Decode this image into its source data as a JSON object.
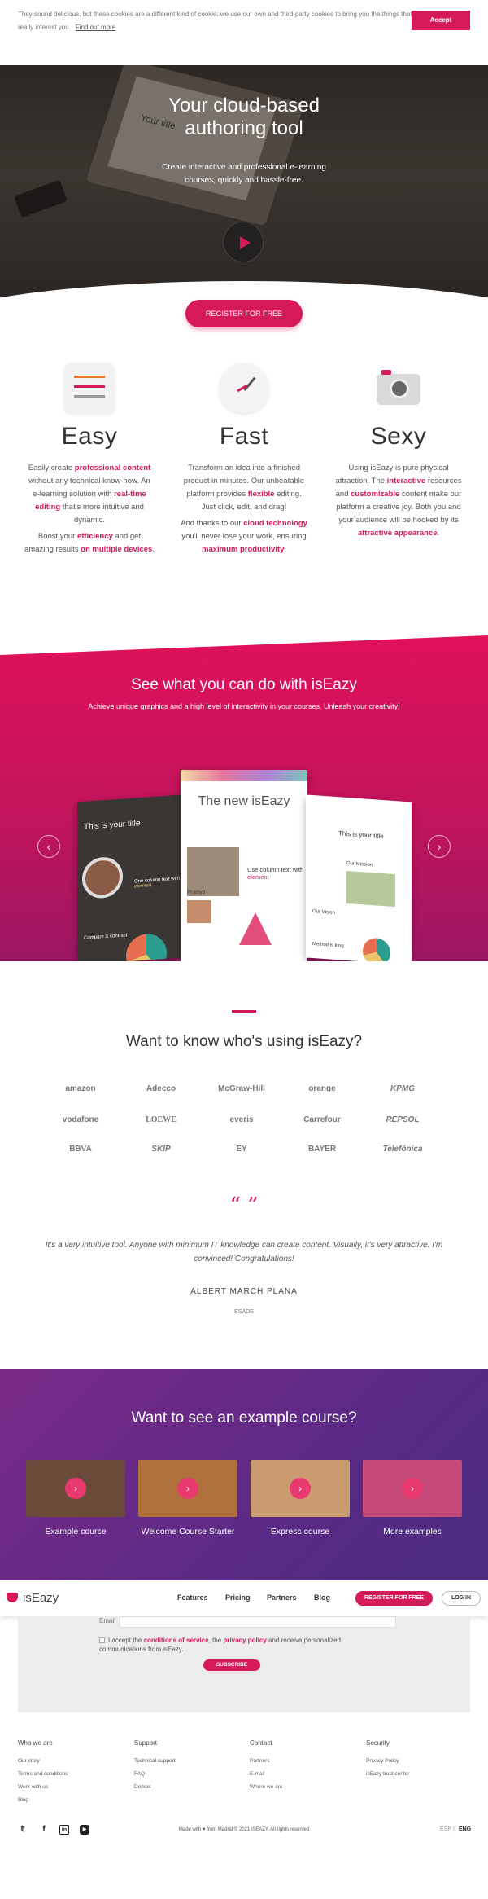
{
  "cookie": {
    "text": "They sound delicious, but these cookies are a different kind of cookie: we use our own and third-party cookies to bring you the things that really interest you.",
    "link": "Find out more",
    "accept": "Accept"
  },
  "hero": {
    "title": "Your cloud-based authoring tool",
    "subtitle": "Create interactive and professional e-learning courses, quickly and hassle-free.",
    "register": "REGISTER FOR FREE",
    "screen_text": "Your title"
  },
  "features": [
    {
      "title": "Easy",
      "p1": "Easily create professional content without any technical know-how. An e-learning solution with real-time editing that's more intuitive and dynamic.",
      "p2": "Boost your efficiency and get amazing results on multiple devices."
    },
    {
      "title": "Fast",
      "p1": "Transform an idea into a finished product in minutes. Our unbeatable platform provides flexible editing. Just click, edit, and drag!",
      "p2": "And thanks to our cloud technology you'll never lose your work, ensuring maximum productivity."
    },
    {
      "title": "Sexy",
      "p1": "Using isEazy is pure physical attraction. The interactive resources and customizable content make our platform a creative joy. Both you and your audience will be hooked by its attractive appearance.",
      "p2": ""
    }
  ],
  "showcase": {
    "title": "See what you can do with isEazy",
    "subtitle": "Achieve unique graphics and a high level of interactivity in your courses. Unleash your creativity!",
    "cards": {
      "left_title": "This is your title",
      "left_text1": "One column text with",
      "left_text1_highlight": "element",
      "left_text2": "Compare & contrast",
      "mid_title": "The new isEazy",
      "mid_text1": "Use column text with",
      "mid_text1_highlight": "element",
      "mid_text2": "Piramyd",
      "right_title": "This is your title",
      "right_text1": "Our Mission",
      "right_text2": "Our Vision",
      "right_text3": "Method is king"
    }
  },
  "clients": {
    "title": "Want to know who's using isEazy?",
    "logos": [
      "amazon",
      "Adecco",
      "McGraw-Hill",
      "orange",
      "KPMG",
      "vodafone",
      "LOEWE",
      "everis",
      "Carrefour",
      "REPSOL",
      "BBVA",
      "SKIP",
      "EY",
      "BAYER",
      "Telefónica"
    ],
    "quote": "It's a very intuitive tool. Anyone with minimum IT knowledge can create content. Visually, it's very attractive. I'm convinced! Congratulations!",
    "author": "ALBERT MARCH PLANA",
    "company": "ESADE"
  },
  "courses": {
    "title": "Want to see an example course?",
    "items": [
      {
        "label": "Example course",
        "color": "#6b4a3a"
      },
      {
        "label": "Welcome Course Starter",
        "color": "#b0703b"
      },
      {
        "label": "Express course",
        "color": "#c99b6e"
      },
      {
        "label": "More examples",
        "color": "#c44a7a"
      }
    ]
  },
  "nav": {
    "brand": "isEazy",
    "items": [
      "Features",
      "Pricing",
      "Partners",
      "Blog"
    ],
    "register": "REGISTER FOR FREE",
    "login": "LOG IN"
  },
  "subscribe": {
    "email_label": "Email",
    "terms_prefix": "I accept the",
    "terms_link1": "conditions of service",
    "terms_mid": ", the",
    "terms_link2": "privacy policy",
    "terms_suffix": "and receive personalized communications from isEazy.",
    "button": "SUBSCRIBE"
  },
  "footer": {
    "columns": [
      {
        "title": "Who we are",
        "links": [
          "Our story",
          "Terms and conditions",
          "Work with us",
          "Blog"
        ]
      },
      {
        "title": "Support",
        "links": [
          "Technical support",
          "FAQ",
          "Demos"
        ]
      },
      {
        "title": "Contact",
        "links": [
          "Partners",
          "E-mail",
          "Where we are"
        ]
      },
      {
        "title": "Security",
        "links": [
          "Privacy Policy",
          "isEazy trust center"
        ]
      }
    ],
    "copyright": "Made with ♥ from Madrid © 2021 iSEAZY. All rights reserved",
    "lang_es": "ESP",
    "lang_sep": "|",
    "lang_en": "ENG"
  },
  "colors": {
    "accent": "#d6195a",
    "purple": "#5a2a86"
  }
}
